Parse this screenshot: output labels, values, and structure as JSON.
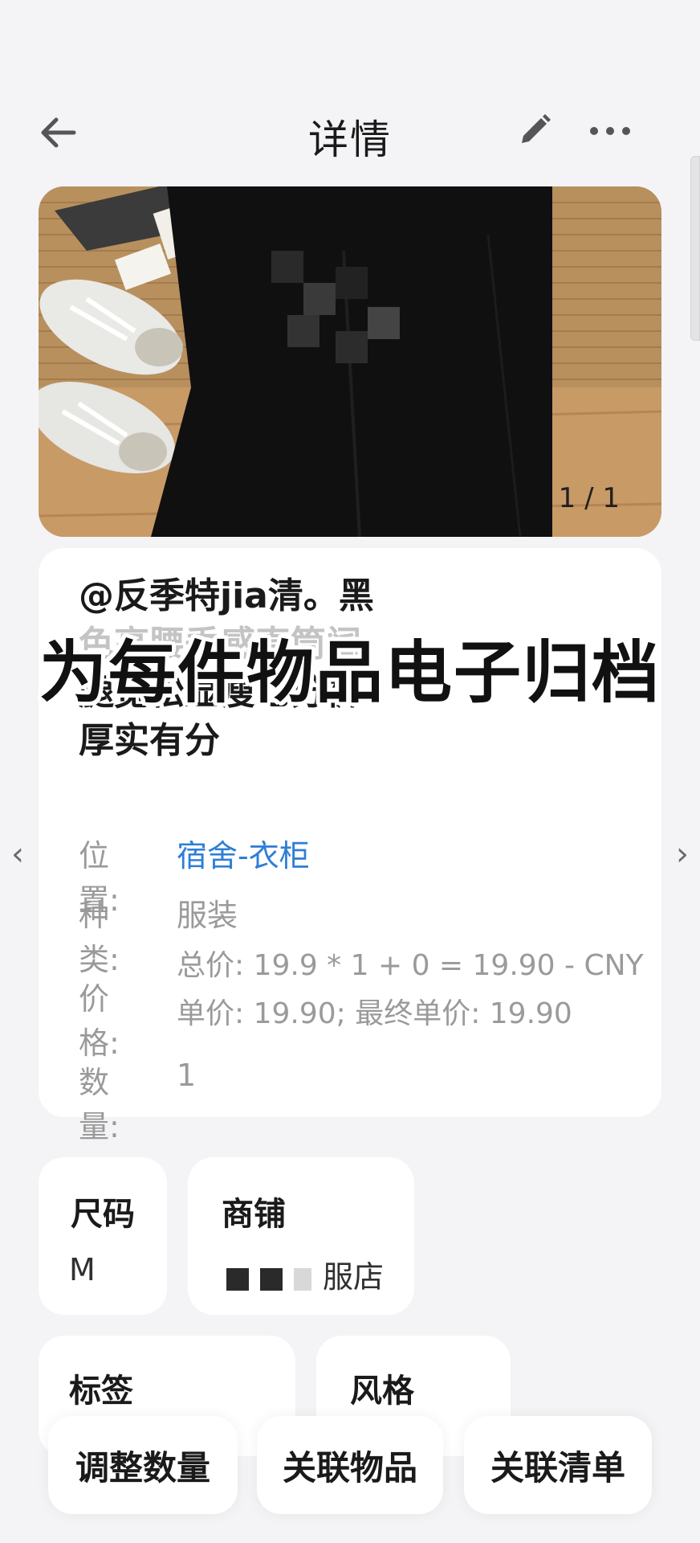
{
  "header": {
    "title": "详情",
    "back_icon": "arrow-left-icon",
    "edit_icon": "pencil-icon",
    "more_icon": "more-dots-icon"
  },
  "photo": {
    "counter": "1 / 1"
  },
  "item": {
    "title_lines": [
      "@反季特jia清。黑",
      "色高腰垂感直筒阔",
      "腿宽松显瘦七分裤",
      "厚实有分"
    ],
    "location_label": "位置:",
    "location_value": "宿舍-衣柜",
    "category_label": "种类:",
    "category_value": "服装",
    "price_label": "价格:",
    "price_total": "总价: 19.9 * 1 + 0 = 19.90 - CNY",
    "price_unit": "单价: 19.90; 最终单价: 19.90",
    "quantity_label": "数量:",
    "quantity_value": "1"
  },
  "overlay_banner": "为每件物品电子归档",
  "nav": {
    "prev": "‹",
    "next": "›"
  },
  "cards": {
    "size_label": "尺码",
    "size_value": "M",
    "shop_label": "商铺",
    "shop_value": "服店",
    "tags_label": "标签",
    "style_label": "风格"
  },
  "actions": {
    "adjust_quantity": "调整数量",
    "link_item": "关联物品",
    "link_list": "关联清单"
  },
  "colors": {
    "background": "#f4f4f6",
    "card": "#ffffff",
    "link": "#2e7ed6",
    "muted": "#9a9a9a"
  }
}
